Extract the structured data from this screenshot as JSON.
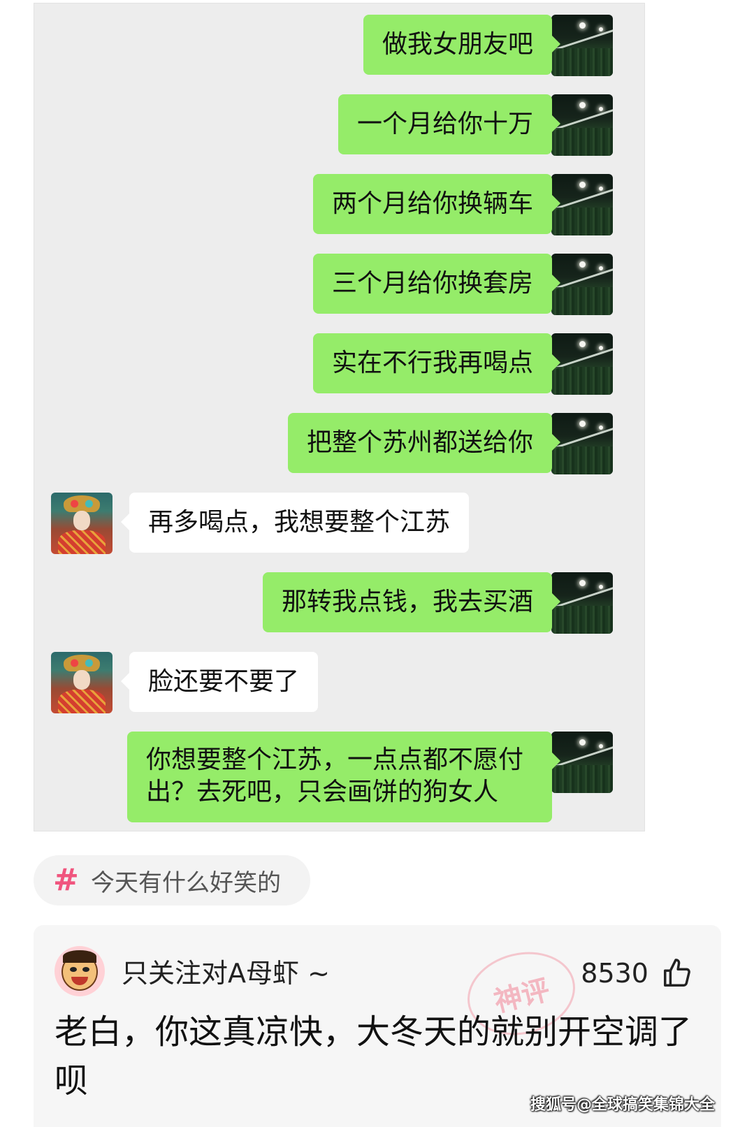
{
  "chat": {
    "messages": [
      {
        "sender": "me",
        "text": "做我女朋友吧"
      },
      {
        "sender": "me",
        "text": "一个月给你十万"
      },
      {
        "sender": "me",
        "text": "两个月给你换辆车"
      },
      {
        "sender": "me",
        "text": "三个月给你换套房"
      },
      {
        "sender": "me",
        "text": "实在不行我再喝点"
      },
      {
        "sender": "me",
        "text": "把整个苏州都送给你"
      },
      {
        "sender": "her",
        "text": "再多喝点，我想要整个江苏"
      },
      {
        "sender": "me",
        "text": "那转我点钱，我去买酒"
      },
      {
        "sender": "her",
        "text": "脸还要不要了"
      },
      {
        "sender": "me",
        "text": "你想要整个江苏，一点点都不愿付出？去死吧，只会画饼的狗女人"
      }
    ],
    "me_bubble_color": "#95ec69",
    "her_bubble_color": "#ffffff",
    "background_color": "#ededed"
  },
  "topic": {
    "icon": "hashtag-icon",
    "label": "今天有什么好笑的",
    "accent_color": "#f0557e"
  },
  "comment": {
    "username": "只关注对A母虾 ~",
    "likes": "8530",
    "like_icon": "thumbs-up-icon",
    "stamp_text": "神评",
    "text": "老白，你这真凉快，大冬天的就别开空调了呗"
  },
  "watermark": "搜狐号@全球搞笑集锦大全"
}
